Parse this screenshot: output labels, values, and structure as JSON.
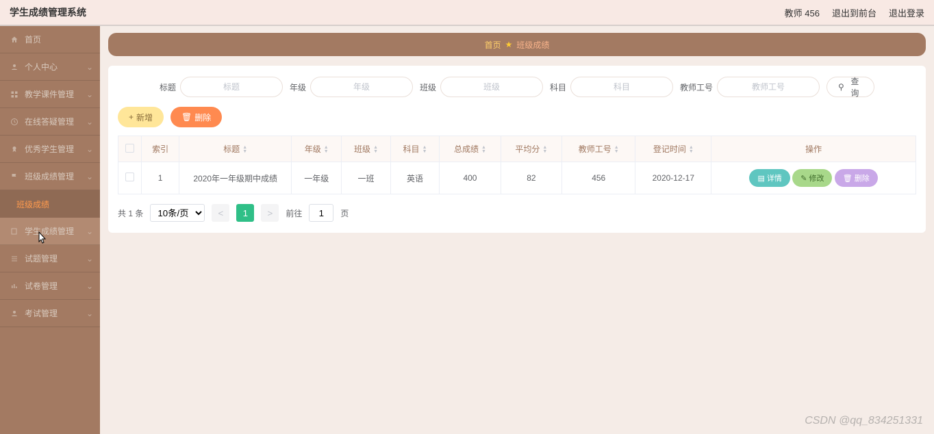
{
  "header": {
    "title": "学生成绩管理系统",
    "user": "教师 456",
    "front": "退出到前台",
    "logout": "退出登录"
  },
  "sidebar": {
    "items": [
      {
        "label": "首页",
        "icon": "home"
      },
      {
        "label": "个人中心",
        "icon": "user",
        "expand": true
      },
      {
        "label": "教学课件管理",
        "icon": "grid",
        "expand": true
      },
      {
        "label": "在线答疑管理",
        "icon": "clock",
        "expand": true
      },
      {
        "label": "优秀学生管理",
        "icon": "medal",
        "expand": true
      },
      {
        "label": "班级成绩管理",
        "icon": "flag",
        "expand": true
      },
      {
        "label": "班级成绩",
        "icon": "",
        "sub": true
      },
      {
        "label": "学生成绩管理",
        "icon": "book",
        "expand": true,
        "hover": true
      },
      {
        "label": "试题管理",
        "icon": "list",
        "expand": true
      },
      {
        "label": "试卷管理",
        "icon": "bars",
        "expand": true
      },
      {
        "label": "考试管理",
        "icon": "person",
        "expand": true
      }
    ]
  },
  "breadcrumb": {
    "home": "首页",
    "current": "班级成绩"
  },
  "filters": {
    "f1": {
      "label": "标题",
      "ph": "标题"
    },
    "f2": {
      "label": "年级",
      "ph": "年级"
    },
    "f3": {
      "label": "班级",
      "ph": "班级"
    },
    "f4": {
      "label": "科目",
      "ph": "科目"
    },
    "f5": {
      "label": "教师工号",
      "ph": "教师工号"
    },
    "search": "查询"
  },
  "actions": {
    "add": "新增",
    "del": "删除"
  },
  "table": {
    "cols": [
      "",
      "索引",
      "标题",
      "年级",
      "班级",
      "科目",
      "总成绩",
      "平均分",
      "教师工号",
      "登记时间",
      "操作"
    ],
    "row": {
      "idx": "1",
      "title": "2020年一年级期中成绩",
      "grade": "一年级",
      "cls": "一班",
      "subject": "英语",
      "total": "400",
      "avg": "82",
      "tid": "456",
      "date": "2020-12-17"
    },
    "btns": {
      "detail": "详情",
      "edit": "修改",
      "del": "删除"
    }
  },
  "pager": {
    "total": "共 1 条",
    "size": "10条/页",
    "page": "1",
    "goto": "前往",
    "goval": "1",
    "unit": "页"
  },
  "watermark": "CSDN @qq_834251331"
}
